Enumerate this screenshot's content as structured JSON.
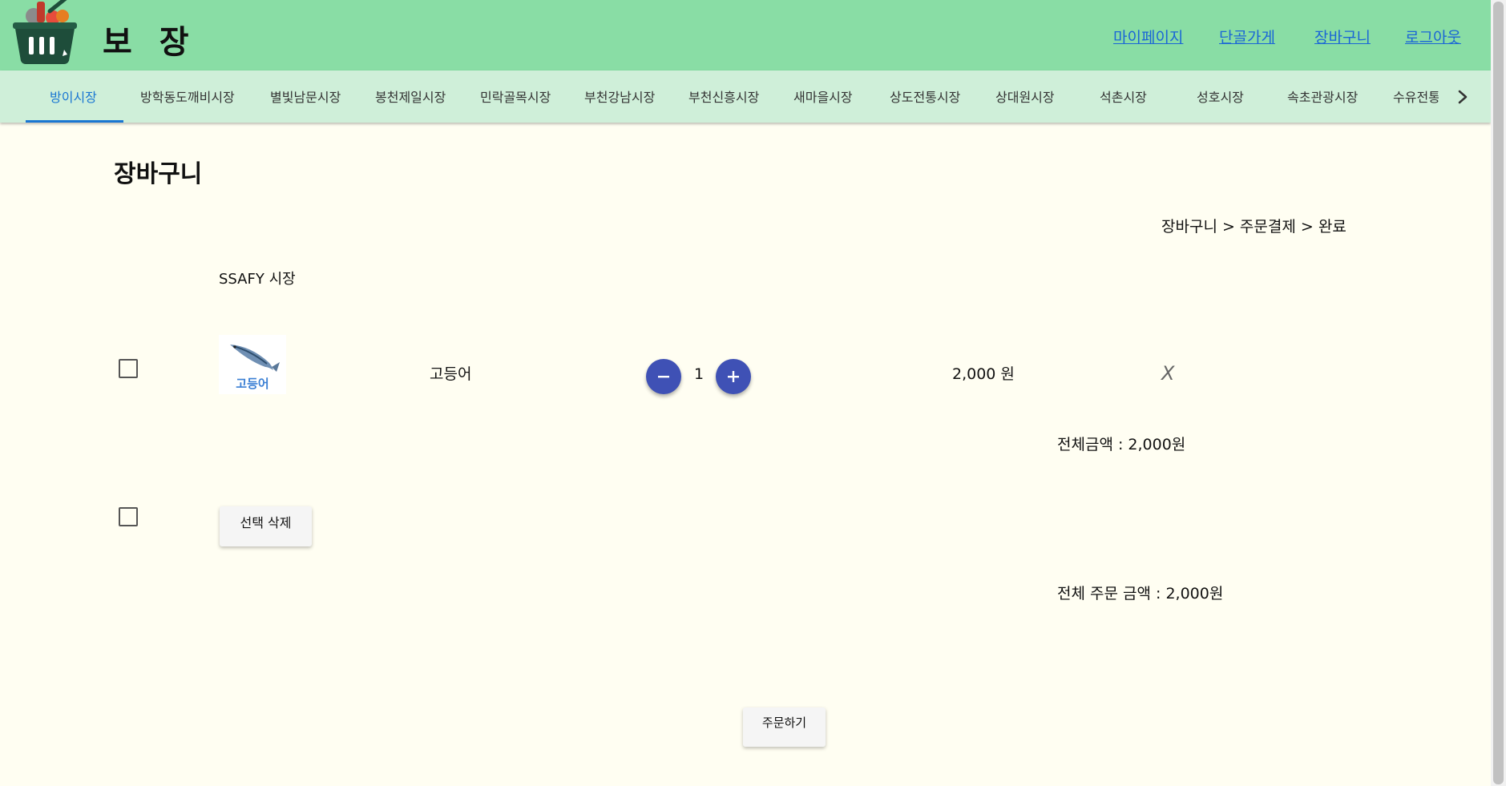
{
  "header": {
    "brand": "보 장",
    "nav": [
      "마이페이지",
      "단골가게",
      "장바구니",
      "로그아웃"
    ]
  },
  "tabs": {
    "items": [
      "방이시장",
      "방학동도깨비시장",
      "별빛남문시장",
      "봉천제일시장",
      "민락골목시장",
      "부천강남시장",
      "부천신흥시장",
      "새마을시장",
      "상도전통시장",
      "상대원시장",
      "석촌시장",
      "성호시장",
      "속초관광시장",
      "수유전통"
    ],
    "active_index": 0
  },
  "page": {
    "title": "장바구니",
    "breadcrumb": "장바구니 > 주문결제 > 완료"
  },
  "cart": {
    "market_name": "SSAFY 시장",
    "items": [
      {
        "thumbnail_label": "고등어",
        "name": "고등어",
        "quantity": "1",
        "price": "2,000 원",
        "remove": "X"
      }
    ],
    "total_amount": "전체금액 : 2,000원"
  },
  "actions": {
    "delete_selected": "선택 삭제",
    "order_total": "전체 주문 금액 : 2,000원",
    "order": "주문하기"
  },
  "colors": {
    "header_bg": "#89DDA5",
    "tabs_bg": "#CFEFD9",
    "page_bg": "#FFFEF2",
    "accent": "#3F51B5",
    "active_tab": "#1976d2",
    "link": "#1a66d6"
  }
}
